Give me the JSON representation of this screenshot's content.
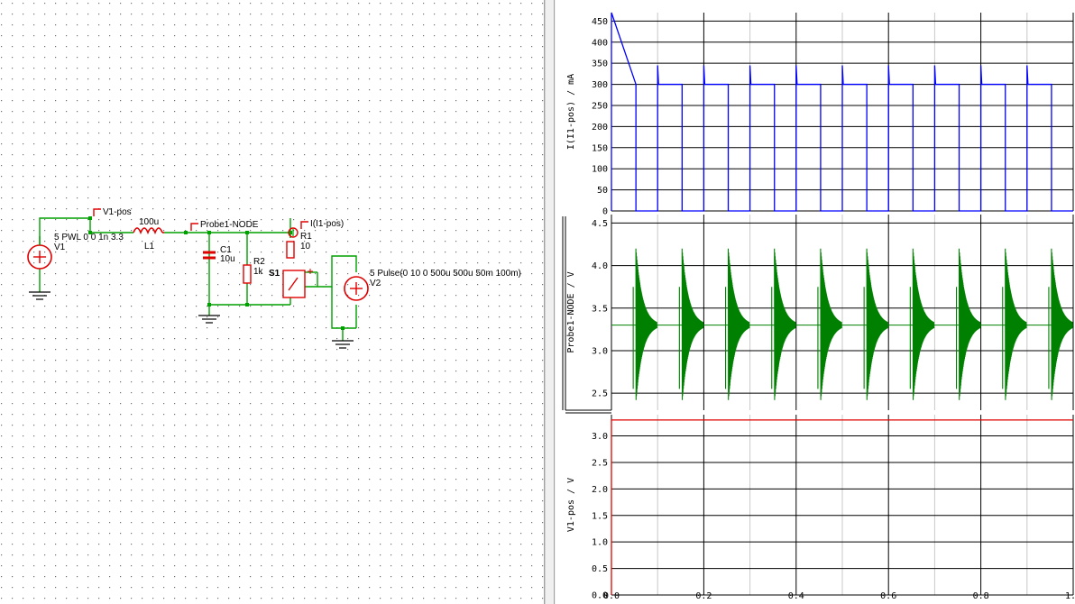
{
  "schematic": {
    "components": {
      "v1": {
        "name": "V1",
        "value": "5 PWL 0 0 1n 3.3"
      },
      "l1": {
        "name": "L1",
        "value": "100u"
      },
      "c1": {
        "name": "C1",
        "value": "10u"
      },
      "r2": {
        "name": "R2",
        "value": "1k"
      },
      "r1": {
        "name": "R1",
        "value": "10"
      },
      "s1": {
        "name": "S1"
      },
      "v2": {
        "name": "V2",
        "value": "5 Pulse(0 10 0 500u 500u 50m 100m)"
      }
    },
    "probes": {
      "v1_pos": "V1-pos",
      "probe1": "Probe1-NODE",
      "i1": "I(I1-pos)"
    },
    "colors": {
      "wire": "#00a000",
      "source": "#e00000",
      "probe": "#e00000",
      "node": "#00a000"
    }
  },
  "plots": {
    "x_ticks": [
      "0.0",
      "0.2",
      "0.4",
      "0.6",
      "0.8",
      "1.0"
    ],
    "panels": [
      {
        "ylabel": "I(I1-pos) / mA",
        "yticks": [
          "0",
          "50",
          "100",
          "150",
          "200",
          "250",
          "300",
          "350",
          "400",
          "450"
        ],
        "color": "#0000ff"
      },
      {
        "ylabel": "Probe1-NODE / V",
        "yticks": [
          "2.5",
          "3.0",
          "3.5",
          "4.0",
          "4.5"
        ],
        "color": "#008000"
      },
      {
        "ylabel": "V1-pos / V",
        "yticks": [
          "0.0",
          "0.5",
          "1.0",
          "1.5",
          "2.0",
          "2.5",
          "3.0"
        ],
        "color": "#e00000"
      }
    ]
  },
  "chart_data": [
    {
      "type": "line",
      "ylabel": "I(I1-pos) / mA",
      "xlim": [
        0,
        1.0
      ],
      "ylim": [
        0,
        470
      ],
      "series": [
        {
          "color": "#0000ff",
          "x": [
            0,
            0,
            0.053,
            0.053,
            0.1,
            0.1,
            0.102,
            0.153,
            0.153,
            0.2,
            0.2,
            0.202,
            0.253,
            0.253,
            0.3,
            0.3,
            0.302,
            0.353,
            0.353,
            0.4,
            0.4,
            0.402,
            0.453,
            0.453,
            0.5,
            0.5,
            0.502,
            0.553,
            0.553,
            0.6,
            0.6,
            0.602,
            0.653,
            0.653,
            0.7,
            0.7,
            0.702,
            0.753,
            0.753,
            0.8,
            0.8,
            0.802,
            0.853,
            0.853,
            0.9,
            0.9,
            0.902,
            0.953,
            0.953,
            1.0
          ],
          "y": [
            0,
            470,
            300,
            0,
            0,
            345,
            300,
            300,
            0,
            0,
            345,
            300,
            300,
            0,
            0,
            345,
            300,
            300,
            0,
            0,
            345,
            300,
            300,
            0,
            0,
            345,
            300,
            300,
            0,
            0,
            345,
            300,
            300,
            0,
            0,
            345,
            300,
            300,
            0,
            0,
            345,
            300,
            300,
            0,
            0,
            345,
            300,
            300,
            0,
            0
          ]
        }
      ]
    },
    {
      "type": "line",
      "ylabel": "Probe1-NODE / V",
      "xlim": [
        0,
        1.0
      ],
      "ylim": [
        2.3,
        4.6
      ],
      "series": [
        {
          "color": "#008000",
          "mean": 3.3,
          "ringing_starts": [
            0.053,
            0.153,
            0.253,
            0.353,
            0.453,
            0.553,
            0.653,
            0.753,
            0.853,
            0.953
          ],
          "peak_max": 4.2,
          "peak_min": 2.42
        }
      ]
    },
    {
      "type": "line",
      "ylabel": "V1-pos / V",
      "xlim": [
        0,
        1.0
      ],
      "ylim": [
        0,
        3.4
      ],
      "series": [
        {
          "color": "#e00000",
          "x": [
            0,
            0,
            1.0
          ],
          "y": [
            0,
            3.3,
            3.3
          ]
        }
      ]
    }
  ]
}
